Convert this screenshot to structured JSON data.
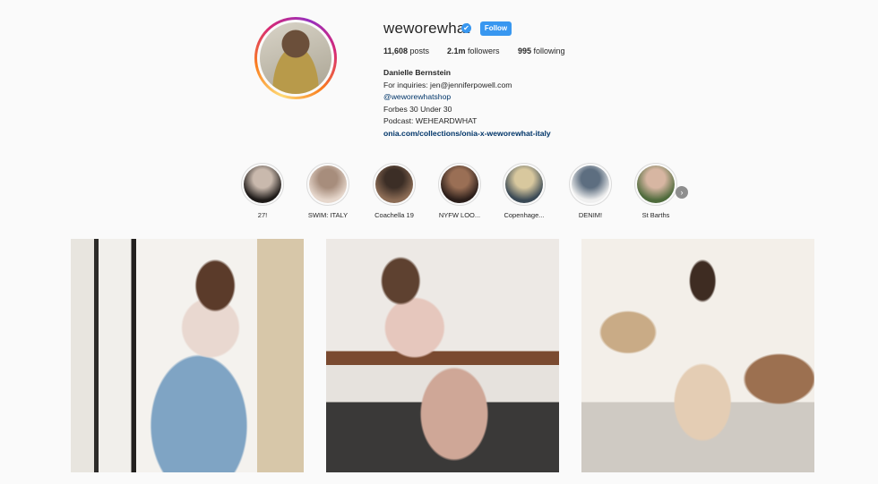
{
  "profile": {
    "username": "weworewhat",
    "verified_badge": "✔",
    "follow_label": "Follow",
    "stats": {
      "posts_count": "11,608",
      "posts_label": "posts",
      "followers_count": "2.1m",
      "followers_label": "followers",
      "following_count": "995",
      "following_label": "following"
    },
    "bio": {
      "full_name": "Danielle Bernstein",
      "line1": "For inquiries: jen@jenniferpowell.com",
      "mention": "@weworewhatshop",
      "line3": "Forbes 30 Under 30",
      "line4": "Podcast: WEHEARDWHAT",
      "link": "onia.com/collections/onia-x-weworewhat-italy"
    }
  },
  "highlights": [
    {
      "label": "27!",
      "colors": [
        "#1e1a18",
        "#c9b9ad"
      ]
    },
    {
      "label": "SWIM: ITALY",
      "colors": [
        "#e6d7cc",
        "#a78d7c"
      ]
    },
    {
      "label": "Coachella 19",
      "colors": [
        "#8c6c55",
        "#3c2e26"
      ]
    },
    {
      "label": "NYFW LOO...",
      "colors": [
        "#2b1e1a",
        "#9a6f55"
      ]
    },
    {
      "label": "Copenhage...",
      "colors": [
        "#3b4a55",
        "#d8c89e"
      ]
    },
    {
      "label": "DENIM!",
      "colors": [
        "#efefef",
        "#5d6e80"
      ]
    },
    {
      "label": "St Barths",
      "colors": [
        "#4f6b3c",
        "#d7b6a2"
      ]
    }
  ],
  "highlights_next_icon": "›",
  "colors": {
    "accent": "#3897f0",
    "link": "#003569",
    "background": "#fafafa"
  }
}
